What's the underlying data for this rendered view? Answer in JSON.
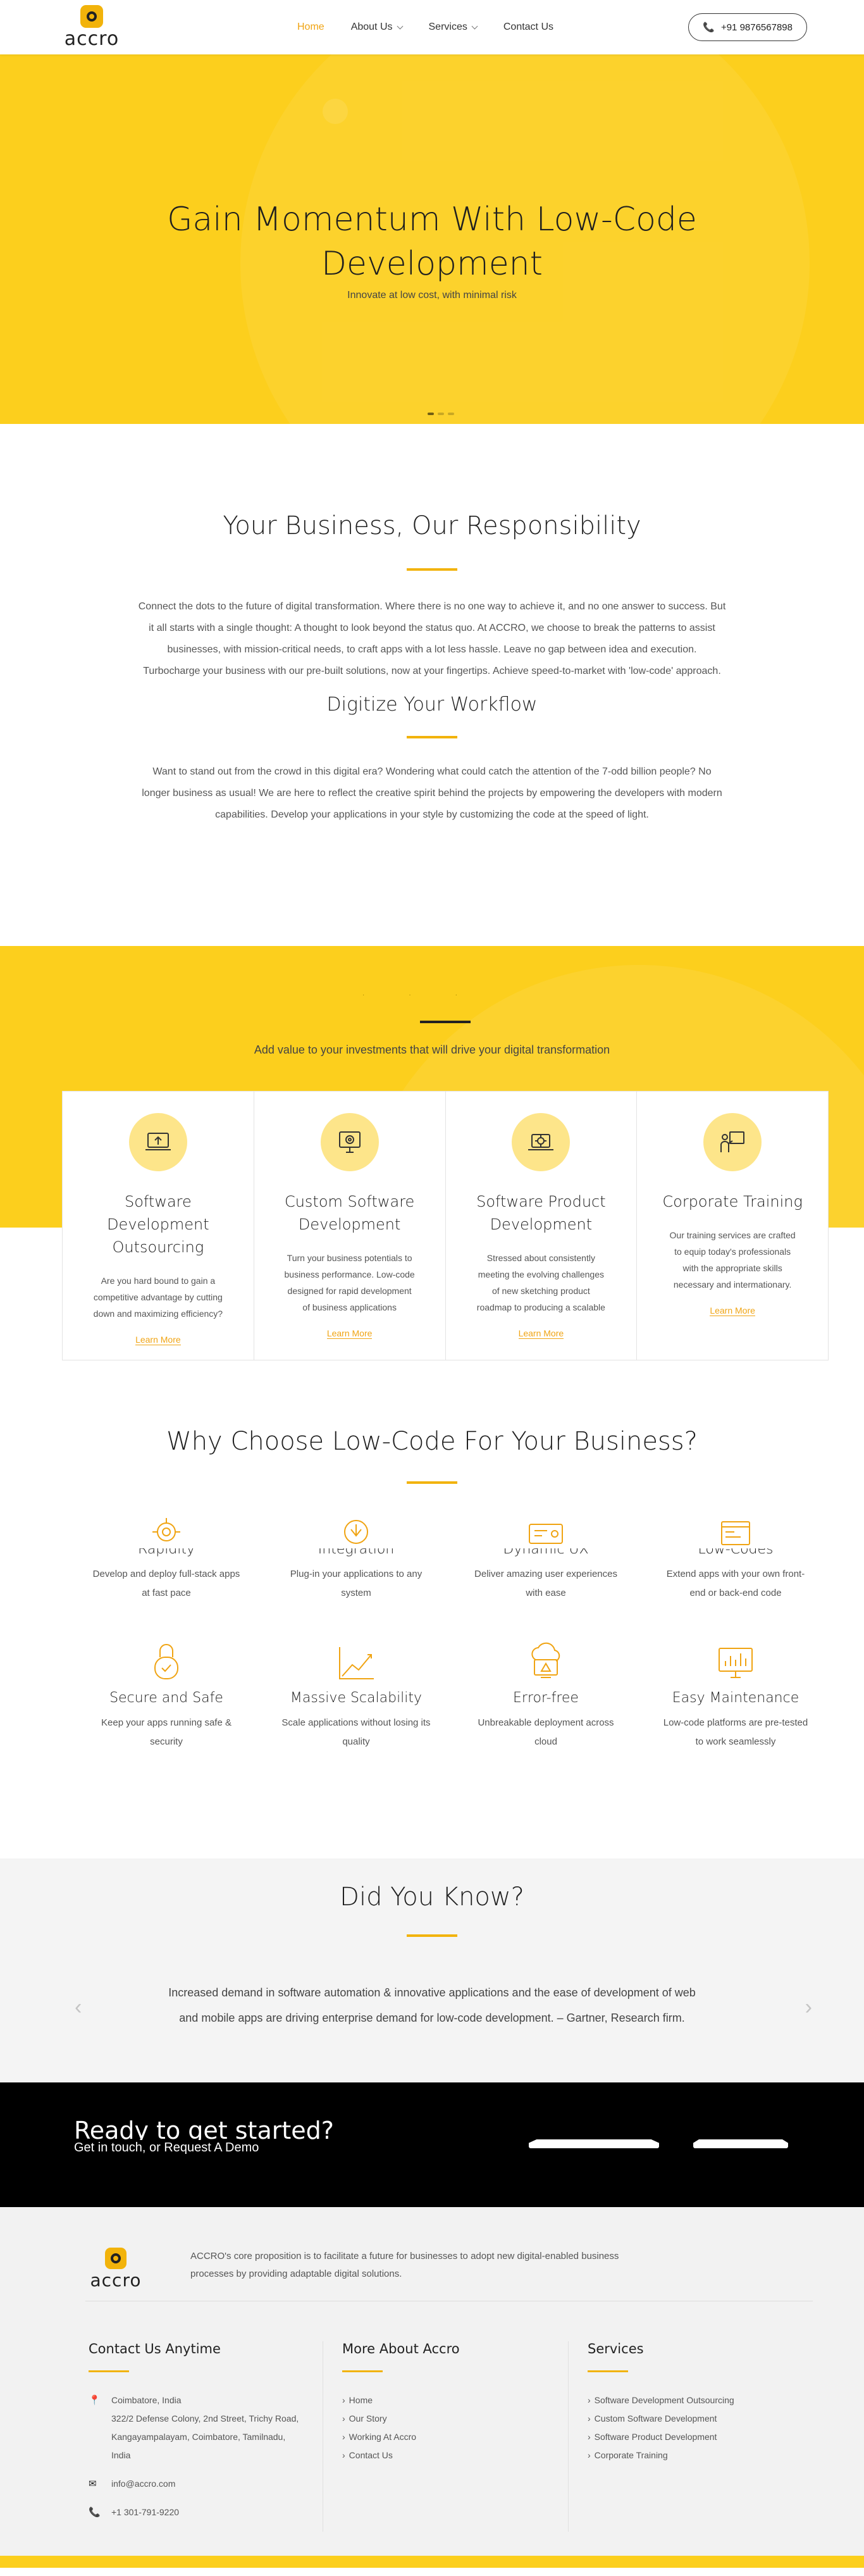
{
  "header": {
    "logo_text": "accro",
    "nav": [
      {
        "label": "Home"
      },
      {
        "label": "About Us"
      },
      {
        "label": "Services"
      },
      {
        "label": "Contact Us"
      }
    ],
    "phone": "+91 9876567898"
  },
  "hero": {
    "title_line1": "Gain Momentum With Low-Code",
    "title_line2": "Development",
    "subtitle": "Innovate at low cost, with minimal risk"
  },
  "intro": {
    "title": "Your Business, Our Responsibility",
    "text": "Connect the dots to the future of digital transformation. Where there is no one way to achieve it, and no one answer to success. But it all starts with a single thought: A thought to look beyond the status quo. At ACCRO, we choose to break the patterns to assist businesses, with mission-critical needs, to craft apps with a lot less hassle. Leave no gap between idea and execution. Turbocharge your business with our pre-built solutions, now at your fingertips. Achieve speed-to-market with 'low-code' approach.",
    "subtitle": "Digitize Your Workflow",
    "text2": "Want to stand out from the crowd in this digital era? Wondering what could catch the attention of the 7-odd billion people? No longer business as usual! We are here to reflect the creative spirit behind the projects by empowering the developers with modern capabilities. Develop your applications in your style by customizing the code at the speed of light."
  },
  "services": {
    "tagline": "Add value to your investments that will drive your digital transformation",
    "cards": [
      {
        "title": "Software Development Outsourcing",
        "text": "Are you hard bound to gain a competitive advantage by cutting down and maximizing efficiency?",
        "link": "Learn More",
        "icon": "laptop-upload-icon"
      },
      {
        "title": "Custom Software Development",
        "text": "Turn your business potentials to business performance. Low-code designed for rapid development of business applications",
        "link": "Learn More",
        "icon": "monitor-gear-icon"
      },
      {
        "title": "Software Product Development",
        "text": "Stressed about consistently meeting the evolving challenges of new sketching product roadmap to producing a scalable",
        "link": "Learn More",
        "icon": "laptop-cog-icon"
      },
      {
        "title": "Corporate Training",
        "text": "Our training services are crafted to equip today's professionals with the appropriate skills necessary and intermationary.",
        "link": "Learn More",
        "icon": "presenter-icon"
      }
    ]
  },
  "why": {
    "title": "Why Choose Low-Code For Your Business?",
    "features": [
      {
        "title": "Rapidity",
        "text": "Develop and deploy full-stack apps at fast pace"
      },
      {
        "title": "Integration",
        "text": "Plug-in your applications to any system"
      },
      {
        "title": "Dynamic UX",
        "text": "Deliver amazing user experiences with ease"
      },
      {
        "title": "Low-Codes",
        "text": "Extend apps with your own front-end or back-end code"
      },
      {
        "title": "Secure and Safe",
        "text": "Keep your apps running safe & security"
      },
      {
        "title": "Massive Scalability",
        "text": "Scale applications without losing its quality"
      },
      {
        "title": "Error-free",
        "text": "Unbreakable deployment across cloud"
      },
      {
        "title": "Easy Maintenance",
        "text": "Low-code platforms are pre-tested to work seamlessly"
      }
    ]
  },
  "dyk": {
    "title": "Did You Know?",
    "text": "Increased demand in software automation & innovative applications and the ease of development of web and mobile apps are driving enterprise demand for low-code development. – Gartner, Research firm."
  },
  "cta": {
    "title": "Ready to get started?",
    "subtitle": "Get in touch, or Request A Demo"
  },
  "footer": {
    "logo_text": "accro",
    "about": "ACCRO's core proposition is to facilitate a future for businesses to adopt new digital-enabled business processes by providing adaptable digital solutions.",
    "contact_title": "Contact Us Anytime",
    "address": "Coimbatore, India\n322/2 Defense Colony, 2nd Street, Trichy Road, Kangayampalayam, Coimbatore, Tamilnadu, India",
    "email": "info@accro.com",
    "phone": "+1 301-791-9220",
    "more_title": "More About Accro",
    "more_links": [
      "Home",
      "Our Story",
      "Working At Accro",
      "Contact Us"
    ],
    "services_title": "Services",
    "service_links": [
      "Software Development Outsourcing",
      "Custom Software Development",
      "Software Product Development",
      "Corporate Training"
    ]
  },
  "colors": {
    "accent": "#fccf1d",
    "link": "#f0a413",
    "dark": "#000000"
  }
}
